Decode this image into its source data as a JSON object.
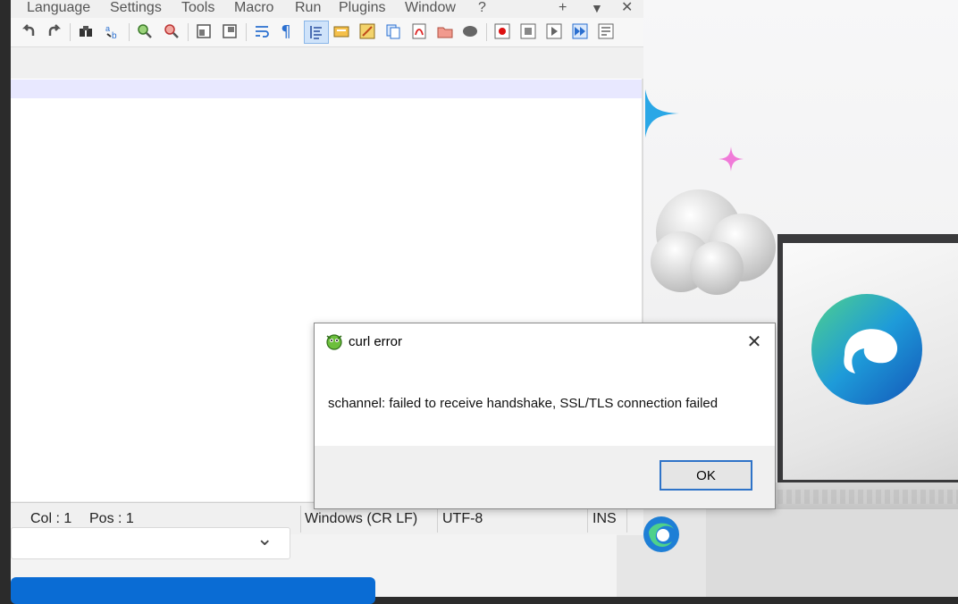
{
  "menu": {
    "items": [
      "Language",
      "Settings",
      "Tools",
      "Macro",
      "Run",
      "Plugins",
      "Window",
      "?"
    ],
    "add_tab": "+",
    "list_tabs": "▼",
    "close": "✕"
  },
  "statusbar": {
    "col": "Col : 1",
    "pos": "Pos : 1",
    "eol": "Windows (CR LF)",
    "encoding": "UTF-8",
    "mode": "INS"
  },
  "dialog": {
    "title": "curl error",
    "message": "schannel: failed to receive handshake, SSL/TLS connection failed",
    "ok_label": "OK",
    "close_glyph": "✕"
  },
  "dropdown": {
    "chevron": "⌄"
  },
  "colors": {
    "current_line": "#e8e8ff",
    "ok_border": "#2e73c8",
    "blue_bar": "#0a6cd4",
    "edge_blue": "#1e7fd6",
    "edge_green": "#4fd18b"
  },
  "toolbar_icons": [
    "undo-icon",
    "redo-icon",
    "find-icon",
    "replace-icon",
    "zoom-in-icon",
    "zoom-out-icon",
    "sync-vertical-icon",
    "sync-horizontal-icon",
    "word-wrap-icon",
    "show-all-characters-icon",
    "indent-guide-icon",
    "document-map-icon",
    "function-list-icon",
    "clone-icon",
    "pdf-icon",
    "folder-workspace-icon",
    "monitoring-icon",
    "macro-record-icon",
    "macro-stop-icon",
    "macro-play-icon",
    "macro-run-multiple-icon",
    "macro-save-icon"
  ]
}
